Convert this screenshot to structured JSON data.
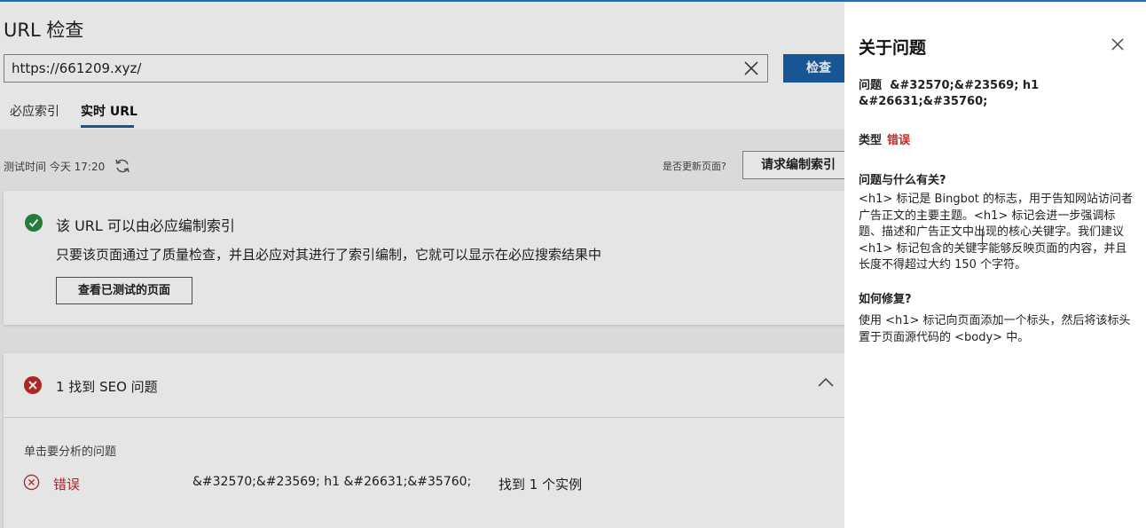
{
  "header": {
    "title": "URL 检查",
    "url_value": "https://661209.xyz/",
    "inspect_label": "检查"
  },
  "tabs": [
    {
      "label": "必应索引"
    },
    {
      "label": "实时 URL"
    }
  ],
  "toolbar": {
    "test_time": "测试时间 今天 17:20",
    "update_question": "是否更新页面?",
    "request_index_label": "请求编制索引"
  },
  "index_card": {
    "title": "该 URL 可以由必应编制索引",
    "description": "只要该页面通过了质量检查，并且必应对其进行了索引编制，它就可以显示在必应搜索结果中",
    "view_button": "查看已测试的页面"
  },
  "seo_card": {
    "title": "1 找到 SEO 问题",
    "hint": "单击要分析的问题",
    "row": {
      "severity": "错误",
      "issue": "&#32570;&#23569; h1 &#26631;&#35760;",
      "found": "找到 1 个实例"
    }
  },
  "panel": {
    "title": "关于问题",
    "issue_label": "问题",
    "issue_value": "&#32570;&#23569; h1 &#26631;&#35760;",
    "type_label": "类型",
    "type_value": "错误",
    "related_heading": "问题与什么有关?",
    "related_body": "<h1> 标记是 Bingbot 的标志，用于告知网站访问者广告正文的主要主题。<h1> 标记会进一步强调标题、描述和广告正文中出现的核心关键字。我们建议 <h1> 标记包含的关键字能够反映页面的内容，并且长度不得超过大约 150 个字符。",
    "fix_heading": "如何修复?",
    "fix_body": "使用 <h1> 标记向页面添加一个标头，然后将该标头置于页面源代码的 <body> 中。"
  },
  "colors": {
    "accent": "#1b5fa6",
    "success": "#2a8a3e",
    "error": "#c22a2a"
  },
  "icons": [
    "clear-icon",
    "refresh-icon",
    "check-circle-icon",
    "error-circle-icon",
    "chevron-up-icon",
    "error-outline-icon",
    "close-icon"
  ]
}
